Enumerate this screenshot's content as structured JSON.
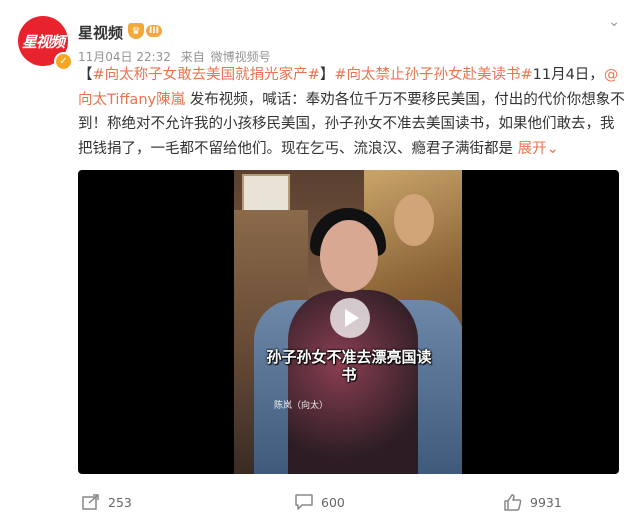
{
  "header": {
    "username": "星视频",
    "avatar_logo": "星视频",
    "level": "III",
    "date": "11月04日 22:32",
    "source_prefix": "来自",
    "source": "微博视频号"
  },
  "content": {
    "bracket_open": "【",
    "tag1": "#向太称子女敢去美国就捐光家产#",
    "bracket_close": "】",
    "tag2": "#向太禁止孙子孙女赴美读书#",
    "date_text": "11月4日，",
    "at_user": "@向太Tiffany陳嵐",
    "body": " 发布视频，喊话：奉劝各位千万不要移民美国，付出的代价你想象不到！称绝对不允许我的小孩移民美国，孙子孙女不准去美国读书，如果他们敢去，我把钱捐了，一毛都不留给他们。现在乞丐、流浪汉、瘾君子满街都是 ",
    "expand": "展开"
  },
  "video": {
    "subtitle": "孙子孙女不准去漂亮国读书",
    "name_tag": "陈岚（向太）"
  },
  "actions": {
    "share_count": "253",
    "comment_count": "600",
    "like_count": "9931"
  }
}
